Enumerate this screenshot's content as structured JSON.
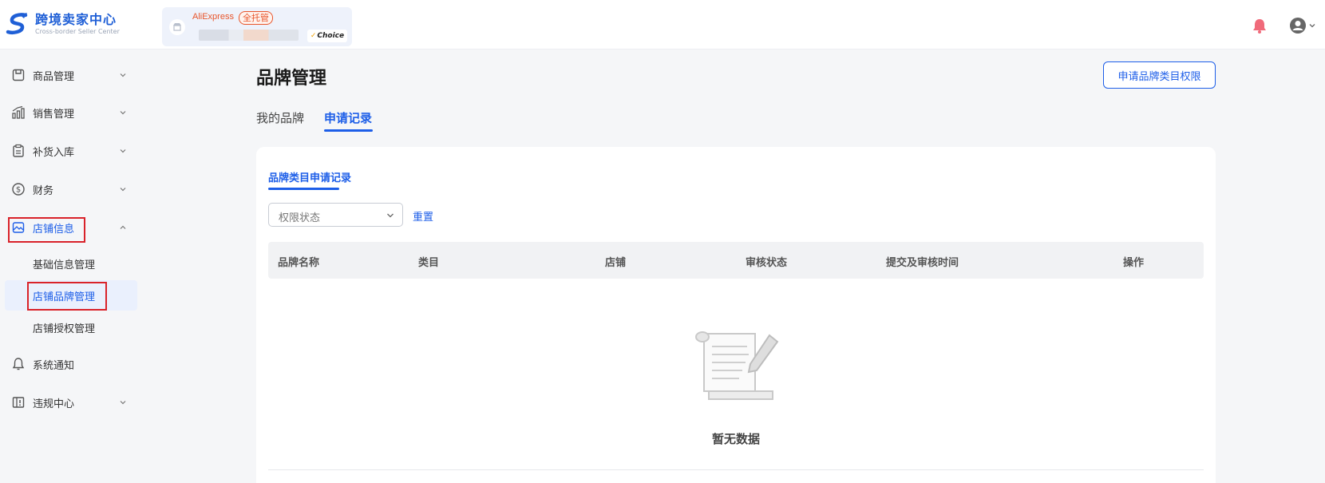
{
  "header": {
    "logo_title": "跨境卖家中心",
    "logo_subtitle": "Cross-border Seller Center",
    "store": {
      "brand": "AliExpress",
      "tag": "全托管",
      "program": "Choice"
    },
    "accent_color": "#1d5ee8"
  },
  "sidebar": {
    "items": [
      {
        "label": "商品管理",
        "icon": "product-box-icon"
      },
      {
        "label": "销售管理",
        "icon": "sales-chart-icon"
      },
      {
        "label": "补货入库",
        "icon": "clipboard-icon"
      },
      {
        "label": "财务",
        "icon": "dollar-icon"
      },
      {
        "label": "店铺信息",
        "icon": "store-image-icon",
        "expanded": true
      },
      {
        "label": "系统通知",
        "icon": "bell-icon"
      },
      {
        "label": "违规中心",
        "icon": "violation-icon"
      }
    ],
    "sub_items": [
      {
        "label": "基础信息管理"
      },
      {
        "label": "店铺品牌管理",
        "selected": true
      },
      {
        "label": "店铺授权管理"
      }
    ]
  },
  "main": {
    "title": "品牌管理",
    "apply_button": "申请品牌类目权限",
    "tabs": [
      {
        "label": "我的品牌"
      },
      {
        "label": "申请记录",
        "active": true
      }
    ],
    "panel": {
      "subtab": "品牌类目申请记录",
      "filter_placeholder": "权限状态",
      "reset_label": "重置",
      "columns": [
        "品牌名称",
        "类目",
        "店铺",
        "审核状态",
        "提交及审核时间",
        "操作"
      ],
      "rows": [],
      "empty_text": "暂无数据"
    }
  }
}
